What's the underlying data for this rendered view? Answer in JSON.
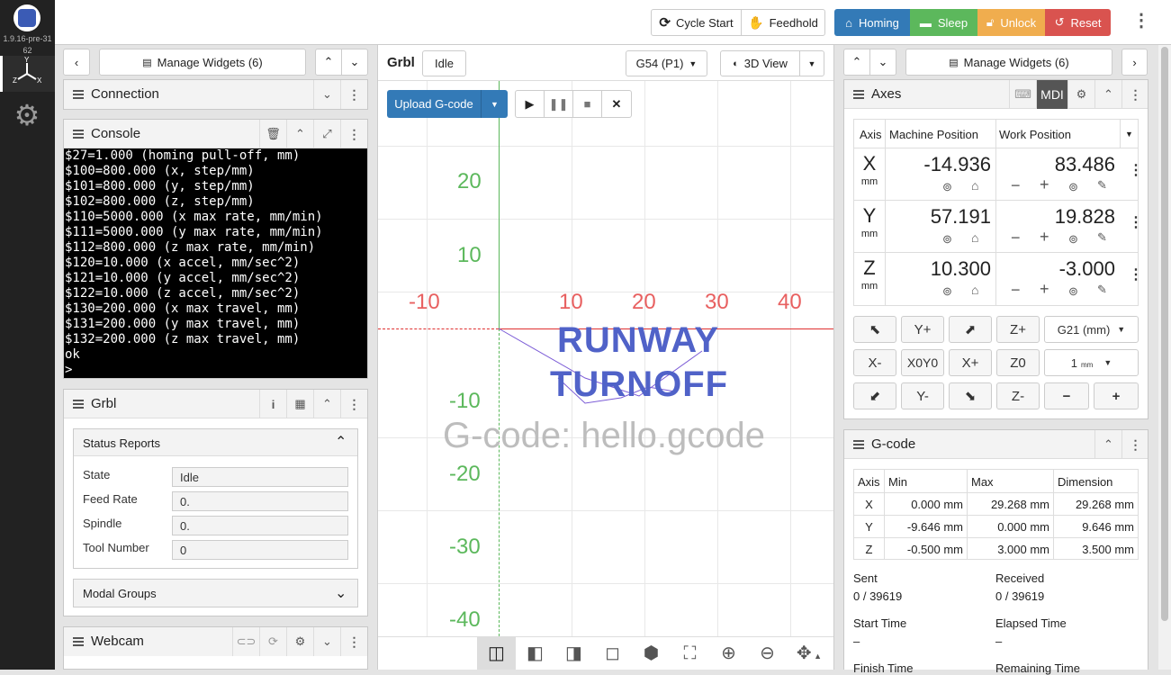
{
  "sidebar": {
    "version": "1.9.16-pre-3162"
  },
  "navbar": {
    "cycle_start": "Cycle Start",
    "feedhold": "Feedhold",
    "homing": "Homing",
    "sleep": "Sleep",
    "unlock": "Unlock",
    "reset": "Reset"
  },
  "colors": {
    "homing": "#337ab7",
    "sleep": "#5cb85c",
    "unlock": "#f0ad4e",
    "reset": "#d9534f",
    "sidebar": "#222222"
  },
  "left": {
    "manage_widgets": "Manage Widgets (6)",
    "connection": "Connection",
    "console_title": "Console",
    "console_lines": [
      "$27=1.000 (homing pull-off, mm)",
      "$100=800.000 (x, step/mm)",
      "$101=800.000 (y, step/mm)",
      "$102=800.000 (z, step/mm)",
      "$110=5000.000 (x max rate, mm/min)",
      "$111=5000.000 (y max rate, mm/min)",
      "$112=800.000 (z max rate, mm/min)",
      "$120=10.000 (x accel, mm/sec^2)",
      "$121=10.000 (y accel, mm/sec^2)",
      "$122=10.000 (z accel, mm/sec^2)",
      "$130=200.000 (x max travel, mm)",
      "$131=200.000 (y max travel, mm)",
      "$132=200.000 (z max travel, mm)",
      "ok",
      ">"
    ],
    "grbl_title": "Grbl",
    "status_reports": "Status Reports",
    "state_label": "State",
    "state_value": "Idle",
    "feed_label": "Feed Rate",
    "feed_value": "0.",
    "spindle_label": "Spindle",
    "spindle_value": "0.",
    "tool_label": "Tool Number",
    "tool_value": "0",
    "modal_groups": "Modal Groups",
    "webcam": "Webcam"
  },
  "center": {
    "controller": "Grbl",
    "state": "Idle",
    "wcs": "G54 (P1)",
    "view": "3D View",
    "upload": "Upload G-code",
    "gcode_label": "G-code: hello.gcode",
    "x_ticks": [
      "-10",
      "10",
      "20",
      "30",
      "40"
    ],
    "y_ticks": [
      "20",
      "10",
      "-10",
      "-20",
      "-30",
      "-40"
    ],
    "runway_text": [
      "RUNWAY",
      "TURNOFF"
    ]
  },
  "right": {
    "manage_widgets": "Manage Widgets (6)",
    "axes_title": "Axes",
    "mdi": "MDI",
    "col_axis": "Axis",
    "col_machine": "Machine Position",
    "col_work": "Work Position",
    "axes": [
      {
        "name": "X",
        "unit": "mm",
        "machine": "-14.936",
        "work": "83.486"
      },
      {
        "name": "Y",
        "unit": "mm",
        "machine": "57.191",
        "work": "19.828"
      },
      {
        "name": "Z",
        "unit": "mm",
        "machine": "10.300",
        "work": "-3.000"
      }
    ],
    "jog": {
      "yplus": "Y+",
      "zplus": "Z+",
      "units": "G21 (mm)",
      "xminus": "X-",
      "x0y0": "X0Y0",
      "xplus": "X+",
      "z0": "Z0",
      "step": "1",
      "step_unit": "mm",
      "yminus": "Y-",
      "zminus": "Z-"
    },
    "gcode_title": "G-code",
    "gtable_headers": [
      "Axis",
      "Min",
      "Max",
      "Dimension"
    ],
    "gtable_rows": [
      [
        "X",
        "0.000 mm",
        "29.268 mm",
        "29.268 mm"
      ],
      [
        "Y",
        "-9.646 mm",
        "0.000 mm",
        "9.646 mm"
      ],
      [
        "Z",
        "-0.500 mm",
        "3.000 mm",
        "3.500 mm"
      ]
    ],
    "sent_label": "Sent",
    "sent_value": "0 / 39619",
    "received_label": "Received",
    "received_value": "0 / 39619",
    "start_label": "Start Time",
    "start_value": "–",
    "elapsed_label": "Elapsed Time",
    "elapsed_value": "–",
    "finish_label": "Finish Time",
    "remaining_label": "Remaining Time"
  }
}
